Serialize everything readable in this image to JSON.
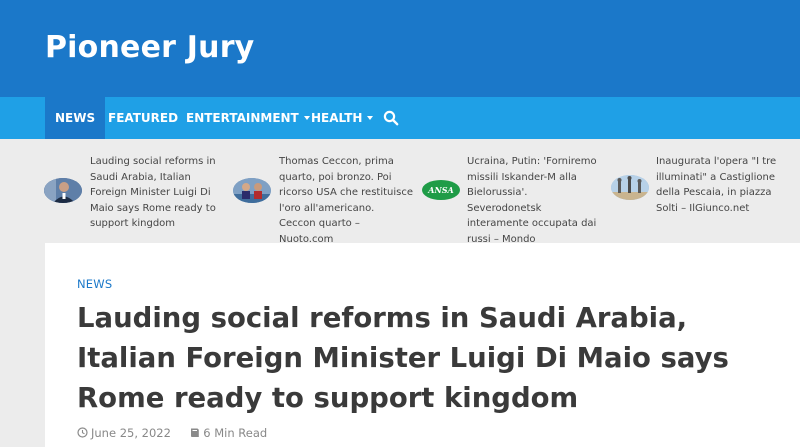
{
  "site": {
    "title": "Pioneer Jury"
  },
  "nav": {
    "items": [
      {
        "label": "NEWS",
        "active": true
      },
      {
        "label": "FEATURED"
      },
      {
        "label": "ENTERTAINMENT",
        "dropdown": true
      },
      {
        "label": "HEALTH",
        "dropdown": true
      }
    ],
    "search_icon": "search-icon"
  },
  "ticker": {
    "items": [
      {
        "text": "Lauding social reforms in Saudi Arabia, Italian Foreign Minister Luigi Di Maio says Rome ready to support kingdom"
      },
      {
        "text": "Thomas Ceccon, prima quarto, poi bronzo. Poi ricorso USA che restituisce l'oro all'americano. Ceccon quarto – Nuoto.com"
      },
      {
        "text": "Ucraina, Putin: 'Forniremo missili Iskander-M alla Bielorussia'. Severodonetsk interamente occupata dai russi – Mondo",
        "thumb_label": "ANSA"
      },
      {
        "text": "Inaugurata l'opera \"I tre illuminati\" a Castiglione della Pescaia, in piazza Solti – IlGiunco.net"
      }
    ]
  },
  "article": {
    "category": "NEWS",
    "headline": "Lauding social reforms in Saudi Arabia, Italian Foreign Minister Luigi Di Maio says Rome ready to support kingdom",
    "date": "June 25, 2022",
    "read_time": "6 Min Read"
  },
  "colors": {
    "header": "#1b78c9",
    "nav": "#1fa0e6",
    "accent": "#1b78c9"
  }
}
